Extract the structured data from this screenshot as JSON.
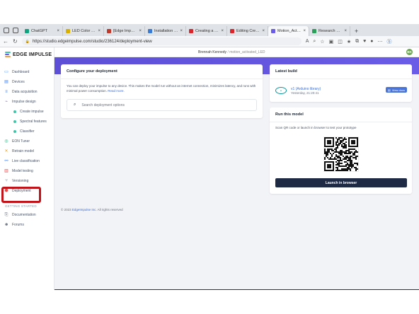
{
  "browser": {
    "tabs": [
      {
        "label": "ChatGPT",
        "color": "#10a37f",
        "active": false
      },
      {
        "label": "LED Color for N",
        "color": "#d8b000",
        "active": false
      },
      {
        "label": "[Edge Impulse]",
        "color": "#c0392b",
        "active": false
      },
      {
        "label": "Installation - Ard",
        "color": "#3a7bd5",
        "active": false
      },
      {
        "label": "Creating a Motio",
        "color": "#d9262c",
        "active": false
      },
      {
        "label": "Editing Creating",
        "color": "#d9262c",
        "active": false
      },
      {
        "label": "Motion_Activat",
        "color": "#6b5ce7",
        "active": true
      },
      {
        "label": "Research Summ",
        "color": "#2e9e5b",
        "active": false
      }
    ],
    "new_tab": "+",
    "url": "https://studio.edgeimpulse.com/studio/236124/deployment-view"
  },
  "app": {
    "logo_text": "EDGE IMPULSE",
    "breadcrumb_user": "Brennah Kennedy",
    "breadcrumb_sep": "/",
    "breadcrumb_project": "motion_activated_LED",
    "avatar_initials": "BK",
    "accent_color": "#6b5ce7"
  },
  "sidebar": {
    "items": [
      {
        "label": "Dashboard",
        "icon": "monitor-icon"
      },
      {
        "label": "Devices",
        "icon": "devices-icon"
      },
      {
        "label": "Data acquisition",
        "icon": "database-icon"
      },
      {
        "label": "Impulse design",
        "icon": "impulse-icon"
      },
      {
        "label": "Create impulse",
        "icon": "dot-icon"
      },
      {
        "label": "Spectral features",
        "icon": "dot-icon"
      },
      {
        "label": "Classifier",
        "icon": "dot-icon"
      },
      {
        "label": "EON Tuner",
        "icon": "tuner-icon"
      },
      {
        "label": "Retrain model",
        "icon": "retrain-icon"
      },
      {
        "label": "Live classification",
        "icon": "live-icon"
      },
      {
        "label": "Model testing",
        "icon": "testing-icon"
      },
      {
        "label": "Versioning",
        "icon": "versioning-icon"
      },
      {
        "label": "Deployment",
        "icon": "deployment-icon"
      }
    ],
    "section_getting_started": "GETTING STARTED",
    "getting_started": [
      {
        "label": "Documentation",
        "icon": "docs-icon"
      },
      {
        "label": "Forums",
        "icon": "forums-icon"
      }
    ]
  },
  "deploy_card": {
    "title": "Configure your deployment",
    "text": "You can deploy your impulse to any device. This makes the model run without an internet connection, minimizes latency, and runs with minimal power consumption.",
    "read_more": "Read more.",
    "search_placeholder": "Search deployment options"
  },
  "latest_build": {
    "title": "Latest build",
    "name": "v1 (Arduino library)",
    "date": "Yesterday, 21:20:41",
    "view_docs": "View docs"
  },
  "run_model": {
    "title": "Run this model",
    "instructions": "Scan QR code or launch in browser to test your prototype",
    "launch_label": "Launch in browser"
  },
  "footer": {
    "copyright": "© 2023",
    "company": "EdgeImpulse Inc.",
    "rights": "All rights reserved"
  }
}
